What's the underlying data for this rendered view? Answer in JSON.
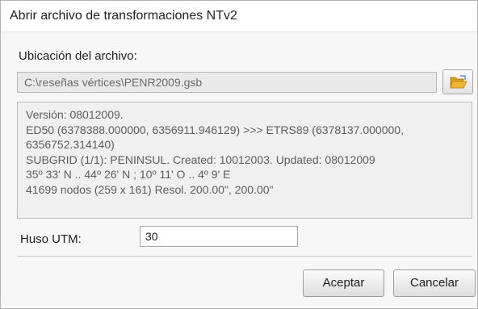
{
  "window": {
    "title": "Abrir archivo de transformaciones NTv2"
  },
  "file_section": {
    "label": "Ubicación del archivo:",
    "path_value": "C:\\reseñas vértices\\PENR2009.gsb",
    "browse_icon": "folder-open-icon"
  },
  "info": {
    "lines": [
      "Versión: 08012009.",
      "ED50    (6378388.000000, 6356911.946129) >>> ETRS89    (6378137.000000,",
      "6356752.314140)",
      "SUBGRID (1/1): PENINSUL. Created: 10012003. Updated: 08012009",
      "35º 33' N .. 44º 26' N  ;  10º 11' O .. 4º 9' E",
      "41699 nodos  (259 x 161)   Resol. 200.00\", 200.00\""
    ]
  },
  "huso": {
    "label": "Huso UTM:",
    "value": "30"
  },
  "buttons": {
    "accept": "Aceptar",
    "cancel": "Cancelar"
  },
  "colors": {
    "dialog_bg": "#f7f7f7",
    "info_bg": "#f0f0f0",
    "path_bg": "#e9e9e9",
    "folder_icon": "#f2b632"
  }
}
